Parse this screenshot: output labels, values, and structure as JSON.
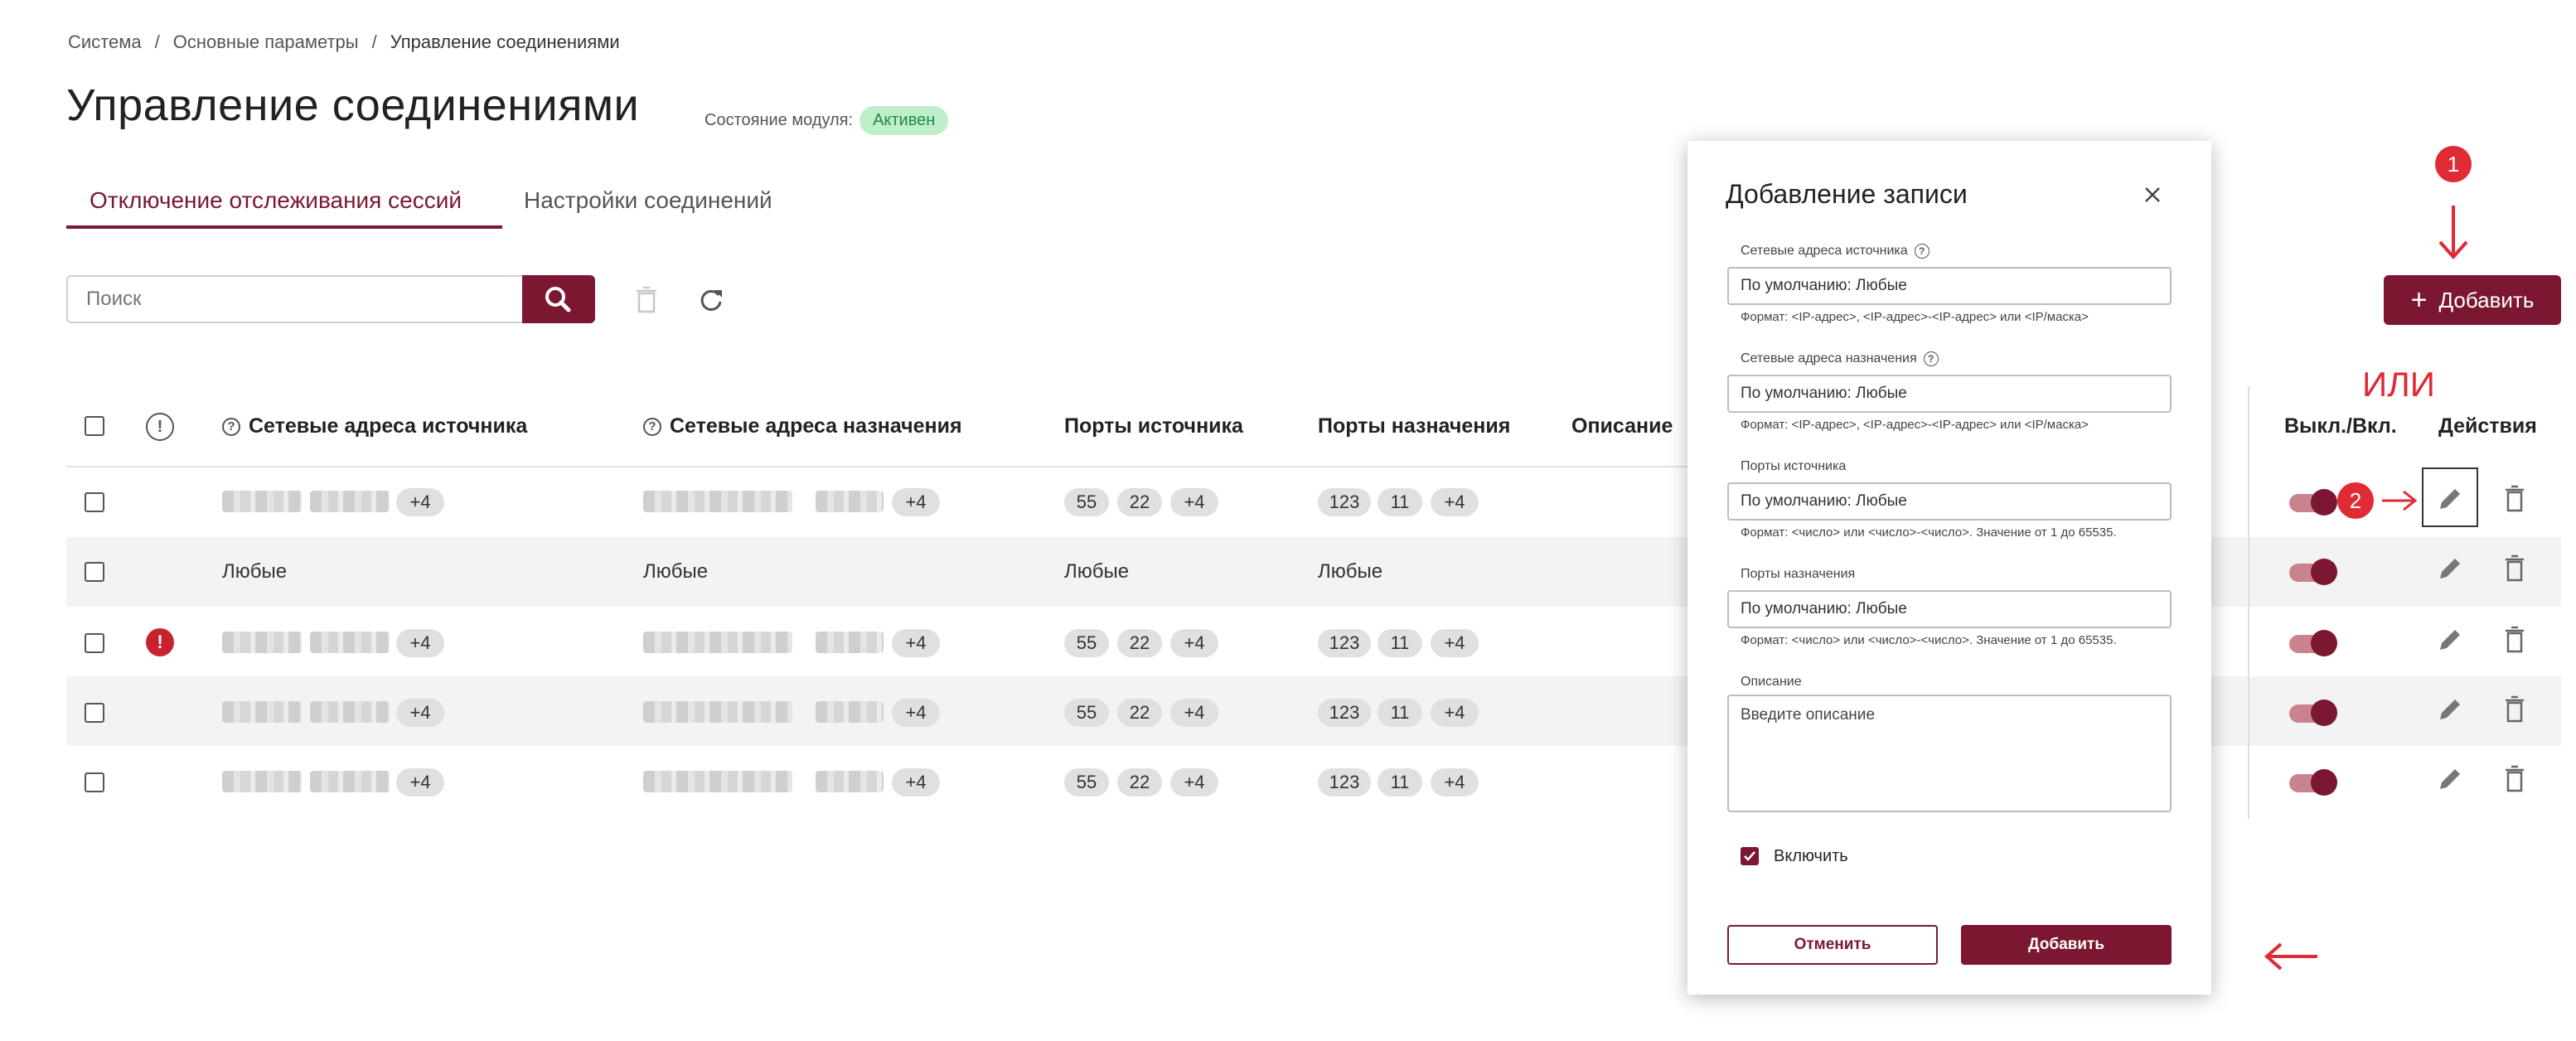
{
  "breadcrumb": {
    "item1": "Система",
    "item2": "Основные параметры",
    "item3": "Управление соединениями",
    "sep": "/"
  },
  "page": {
    "title": "Управление соединениями",
    "status_label": "Состояние модуля:",
    "status_badge": "Активен"
  },
  "tabs": {
    "active": "Отключение отслеживания сессий",
    "inactive": "Настройки соединений"
  },
  "search": {
    "placeholder": "Поиск"
  },
  "toolbar": {
    "add_label": "Добавить"
  },
  "annotations": {
    "marker1": "1",
    "marker2": "2",
    "or_text": "ИЛИ"
  },
  "table": {
    "headers": {
      "src_addr": "Сетевые адреса источника",
      "dst_addr": "Сетевые адреса назначения",
      "src_ports": "Порты источника",
      "dst_ports": "Порты назначения",
      "description": "Описание",
      "toggle": "Выкл./Вкл.",
      "actions": "Действия"
    },
    "any_value": "Любые",
    "chips": {
      "more": "+4",
      "sp1": "55",
      "sp2": "22",
      "dp1": "123",
      "dp2": "11"
    }
  },
  "dialog": {
    "title": "Добавление записи",
    "src_addr_label": "Сетевые адреса источника",
    "src_addr_value": "По умолчанию: Любые",
    "src_addr_help": "Формат: <IP-адрес>, <IP-адрес>-<IP-адрес> или <IP/маска>",
    "dst_addr_label": "Сетевые адреса назначения",
    "dst_addr_value": "По умолчанию: Любые",
    "dst_addr_help": "Формат: <IP-адрес>, <IP-адрес>-<IP-адрес> или <IP/маска>",
    "src_ports_label": "Порты источника",
    "src_ports_value": "По умолчанию: Любые",
    "src_ports_help": "Формат: <число> или <число>-<число>. Значение от 1 до 65535.",
    "dst_ports_label": "Порты назначения",
    "dst_ports_value": "По умолчанию: Любые",
    "dst_ports_help": "Формат: <число> или <число>-<число>. Значение от 1 до 65535.",
    "description_label": "Описание",
    "description_placeholder": "Введите описание",
    "enable_label": "Включить",
    "cancel_label": "Отменить",
    "submit_label": "Добавить"
  },
  "colors": {
    "brand": "#7b1731",
    "annotation": "#e02a34",
    "badge_bg": "#bfeecb",
    "badge_text": "#1e8a44"
  },
  "icons": [
    "search-icon",
    "delete-icon",
    "refresh-icon",
    "plus-icon",
    "help-icon",
    "alert-icon",
    "edit-icon",
    "trash-icon",
    "close-icon",
    "arrow-down-icon",
    "arrow-right-icon",
    "arrow-left-icon"
  ]
}
